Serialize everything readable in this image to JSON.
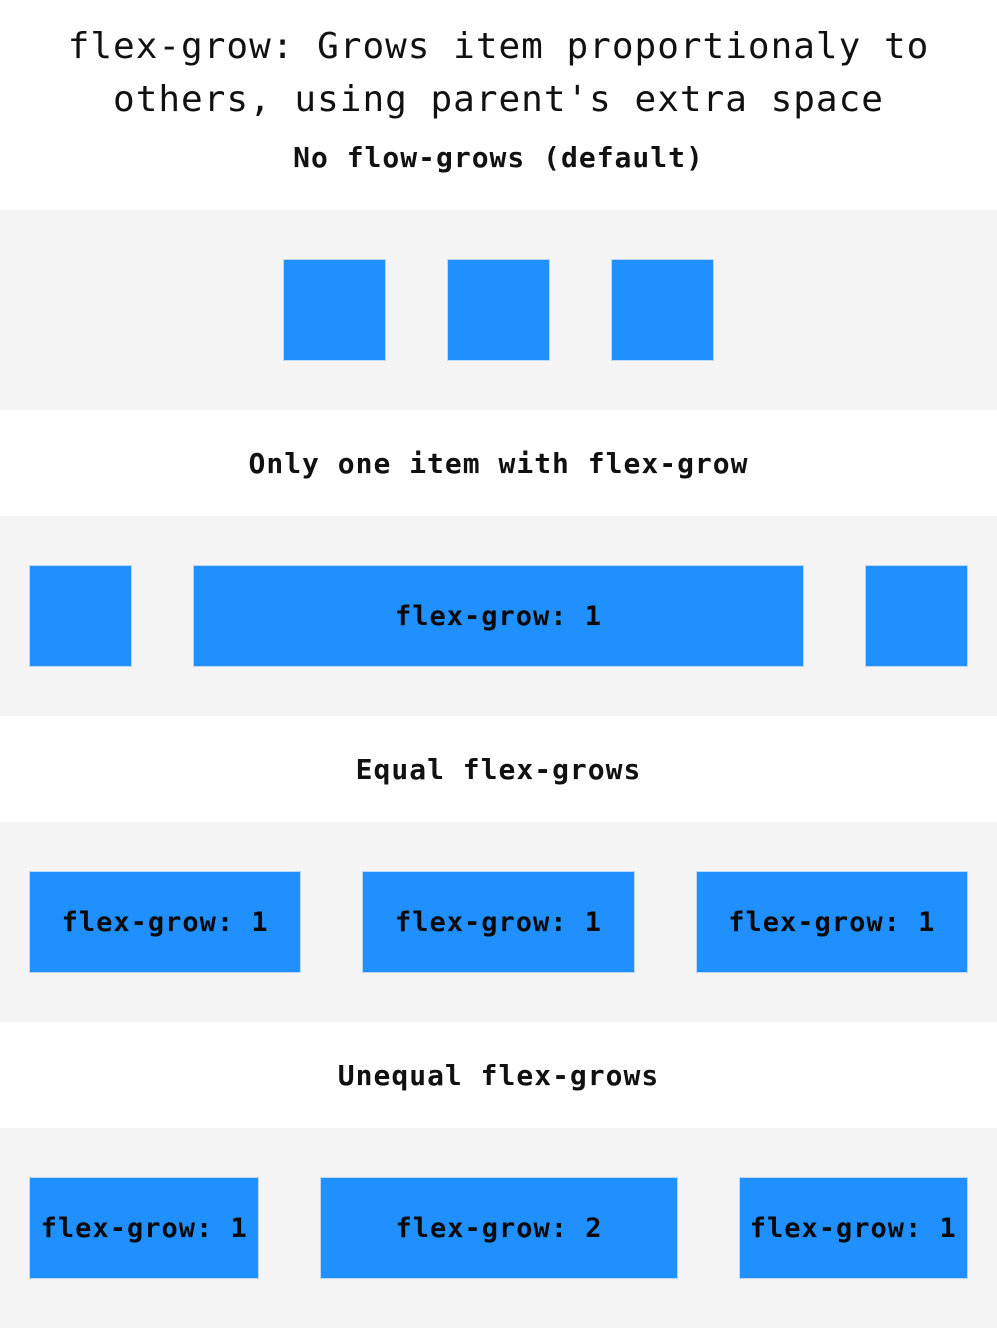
{
  "title": {
    "line1": "flex-grow: Grows item proportionaly to",
    "line2": "others, using parent's extra space"
  },
  "sections": [
    {
      "heading": "No flow-grows (default)",
      "items": [
        {
          "label": "",
          "flex_grow": 0
        },
        {
          "label": "",
          "flex_grow": 0
        },
        {
          "label": "",
          "flex_grow": 0
        }
      ]
    },
    {
      "heading": "Only one item with flex-grow",
      "items": [
        {
          "label": "",
          "flex_grow": 0
        },
        {
          "label": "flex-grow: 1",
          "flex_grow": 1
        },
        {
          "label": "",
          "flex_grow": 0
        }
      ]
    },
    {
      "heading": "Equal flex-grows",
      "items": [
        {
          "label": "flex-grow: 1",
          "flex_grow": 1
        },
        {
          "label": "flex-grow: 1",
          "flex_grow": 1
        },
        {
          "label": "flex-grow: 1",
          "flex_grow": 1
        }
      ]
    },
    {
      "heading": "Unequal flex-grows",
      "items": [
        {
          "label": "flex-grow: 1",
          "flex_grow": 1
        },
        {
          "label": "flex-grow: 2",
          "flex_grow": 2
        },
        {
          "label": "flex-grow: 1",
          "flex_grow": 1
        }
      ]
    }
  ],
  "colors": {
    "item_fill": "#2190ff",
    "item_border": "#bcd8f5",
    "row_background": "#f4f4f4",
    "text": "#111111"
  }
}
